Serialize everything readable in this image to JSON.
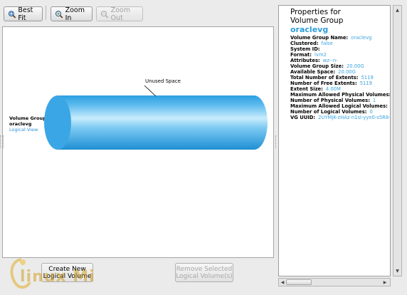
{
  "toolbar": {
    "best_fit": "Best Fit",
    "zoom_in": "Zoom In",
    "zoom_out": "Zoom Out"
  },
  "canvas": {
    "vg_title": "Volume Group",
    "vg_name": "oraclevg",
    "vg_link": "Logical View",
    "unused_label": "Unused Space"
  },
  "properties": {
    "header_line1": "Properties for",
    "header_line2": "Volume Group",
    "name": "oraclevg",
    "rows": [
      {
        "key": "Volume Group Name:",
        "value": "oraclevg"
      },
      {
        "key": "Clustered:",
        "value": "false"
      },
      {
        "key": "System ID:",
        "value": ""
      },
      {
        "key": "Format:",
        "value": "lvm2"
      },
      {
        "key": "Attributes:",
        "value": "wz--n-"
      },
      {
        "key": "Volume Group Size:",
        "value": "20.00G"
      },
      {
        "key": "Available Space:",
        "value": "20.00G"
      },
      {
        "key": "Total Number of Extents:",
        "value": "5119"
      },
      {
        "key": "Number of Free Extents:",
        "value": "5119"
      },
      {
        "key": "Extent Size:",
        "value": "4.00M"
      },
      {
        "key": "Maximum Allowed Physical Volumes:",
        "value": "0"
      },
      {
        "key": "Number of Physical Volumes:",
        "value": "1"
      },
      {
        "key": "Maximum Allowed Logical Volumes:",
        "value": "0"
      },
      {
        "key": "Number of Logical Volumes:",
        "value": "0"
      },
      {
        "key": "VG UUID:",
        "value": "2UYMjK-zHAz-n1sl-yye0-s5R8-..."
      }
    ]
  },
  "bottom": {
    "create_line1": "Create New",
    "create_line2": "Logical Volume",
    "remove_line1": "Remove Selected",
    "remove_line2": "Logical Volume(s)"
  },
  "watermark": {
    "text": "linux Mi"
  },
  "colors": {
    "cylinder": "#2ea3e3",
    "cylinder_highlight": "#c8ecfc",
    "value_blue": "#3aa4de"
  }
}
